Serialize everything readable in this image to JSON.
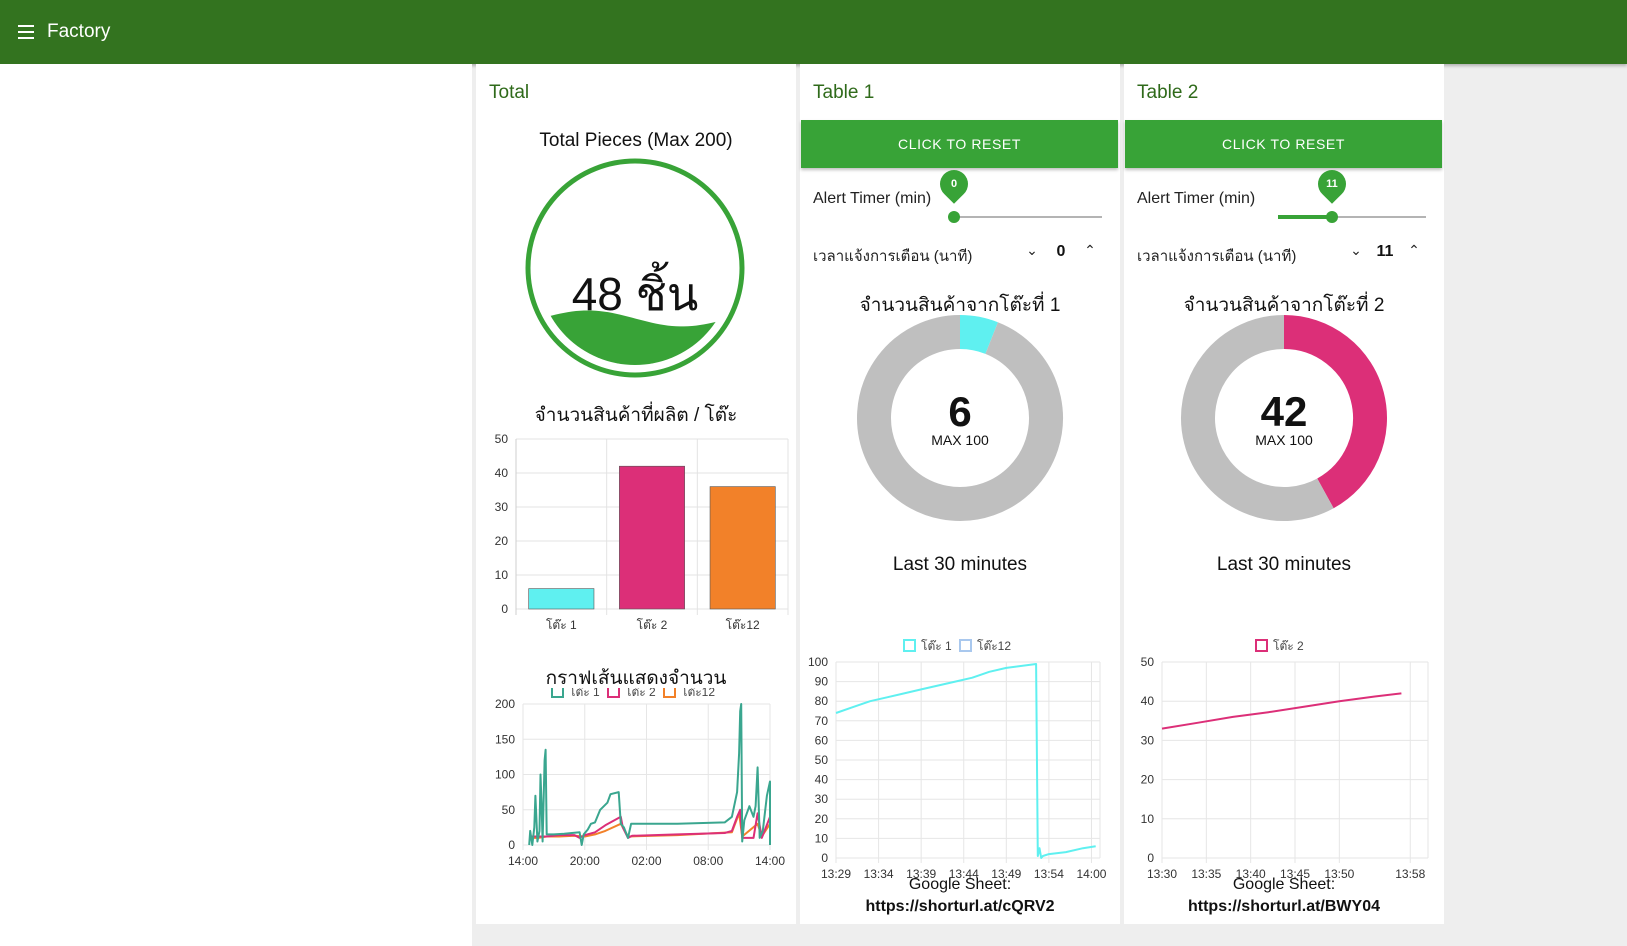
{
  "topbar": {
    "title": "Factory",
    "menu_icon": "hamburger-menu-icon"
  },
  "total": {
    "group_title": "Total",
    "gauge": {
      "title": "Total Pieces (Max 200)",
      "value": 48,
      "max": 200,
      "text": "48 ชิ้น",
      "color": "#38a337"
    },
    "bar_title": "จำนวนสินค้าที่ผลิต / โต๊ะ",
    "line_title": "กราฟเส้นแสดงจำนวน"
  },
  "table1": {
    "group_title": "Table 1",
    "reset_label": "CLICK TO RESET",
    "slider_label": "Alert Timer (min)",
    "slider_value": 0,
    "slider_max": 60,
    "numeric_label": "เวลาแจ้งการเตือน (นาที)",
    "numeric_value": "0",
    "donut_title": "จำนวนสินค้าจากโต๊ะที่ 1",
    "donut_value": "6",
    "donut_max_label": "MAX 100",
    "line_title": "Last 30 minutes",
    "sheet_label": "Google Sheet:",
    "sheet_link": "https://shorturl.at/cQRV2"
  },
  "table2": {
    "group_title": "Table 2",
    "reset_label": "CLICK TO RESET",
    "slider_label": "Alert Timer (min)",
    "slider_value": 11,
    "slider_max": 30,
    "numeric_label": "เวลาแจ้งการเตือน (นาที)",
    "numeric_value": "11",
    "donut_title": "จำนวนสินค้าจากโต๊ะที่ 2",
    "donut_value": "42",
    "donut_max_label": "MAX 100",
    "line_title": "Last 30 minutes",
    "sheet_label": "Google Sheet:",
    "sheet_link": "https://shorturl.at/BWY04"
  },
  "chart_data": [
    {
      "id": "totalGauge",
      "type": "gauge",
      "title": "Total Pieces (Max 200)",
      "value": 48,
      "max": 200,
      "label": "48 ชิ้น",
      "color": "#38a337"
    },
    {
      "id": "totalBar",
      "type": "bar",
      "title": "จำนวนสินค้าที่ผลิต / โต๊ะ",
      "categories": [
        "โต๊ะ 1",
        "โต๊ะ 2",
        "โต๊ะ12"
      ],
      "values": [
        6,
        42,
        36
      ],
      "colors": [
        "#5ff0f0",
        "#dc2f78",
        "#f28129"
      ],
      "ylim": [
        0,
        50
      ],
      "yticks": [
        0,
        10,
        20,
        30,
        40,
        50
      ],
      "grid": true
    },
    {
      "id": "totalLine",
      "type": "line",
      "title": "กราฟเส้นแสดงจำนวน",
      "ylim": [
        0,
        200
      ],
      "yticks": [
        0,
        50,
        100,
        150,
        200
      ],
      "xlim": [
        0,
        24
      ],
      "xticks": [
        0,
        6,
        12,
        18,
        24
      ],
      "xtick_labels": [
        "14:00",
        "20:00",
        "02:00",
        "08:00",
        "14:00"
      ],
      "legend": "top",
      "series": [
        {
          "name": "โต๊ะ 1",
          "color": "#3aa68f",
          "points": [
            [
              0.6,
              0
            ],
            [
              0.7,
              20
            ],
            [
              0.9,
              0
            ],
            [
              1.1,
              25
            ],
            [
              1.2,
              70
            ],
            [
              1.4,
              5
            ],
            [
              1.6,
              20
            ],
            [
              1.7,
              100
            ],
            [
              1.8,
              60
            ],
            [
              1.9,
              5
            ],
            [
              2.1,
              120
            ],
            [
              2.2,
              135
            ],
            [
              2.3,
              15
            ],
            [
              3.0,
              15
            ],
            [
              4.0,
              16
            ],
            [
              5.5,
              18
            ],
            [
              5.7,
              0
            ],
            [
              5.9,
              15
            ],
            [
              6.3,
              22
            ],
            [
              6.6,
              30
            ],
            [
              7.0,
              32
            ],
            [
              7.5,
              50
            ],
            [
              8.2,
              60
            ],
            [
              8.5,
              72
            ],
            [
              9.3,
              75
            ],
            [
              9.5,
              30
            ],
            [
              9.8,
              25
            ],
            [
              10.2,
              10
            ],
            [
              10.5,
              30
            ],
            [
              11.5,
              30
            ],
            [
              15.0,
              30
            ],
            [
              19.6,
              32
            ],
            [
              20.3,
              40
            ],
            [
              20.8,
              75
            ],
            [
              21.0,
              130
            ],
            [
              21.1,
              190
            ],
            [
              21.2,
              200
            ],
            [
              21.3,
              5
            ],
            [
              21.5,
              35
            ],
            [
              22.0,
              55
            ],
            [
              22.4,
              40
            ],
            [
              22.6,
              55
            ],
            [
              22.8,
              110
            ],
            [
              23.0,
              10
            ],
            [
              23.3,
              20
            ],
            [
              23.7,
              70
            ],
            [
              24.0,
              90
            ],
            [
              24.0,
              0
            ]
          ]
        },
        {
          "name": "โต๊ะ 2",
          "color": "#dc2f78",
          "points": [
            [
              0.7,
              12
            ],
            [
              1.5,
              12
            ],
            [
              2.3,
              12
            ],
            [
              3.5,
              14
            ],
            [
              5.0,
              14
            ],
            [
              5.5,
              10
            ],
            [
              6.0,
              14
            ],
            [
              7.0,
              18
            ],
            [
              8.0,
              28
            ],
            [
              9.5,
              40
            ],
            [
              9.7,
              25
            ],
            [
              10.2,
              10
            ],
            [
              10.6,
              13
            ],
            [
              15.0,
              15
            ],
            [
              19.6,
              17
            ],
            [
              20.3,
              20
            ],
            [
              20.8,
              40
            ],
            [
              21.1,
              50
            ],
            [
              21.3,
              10
            ],
            [
              22.4,
              10
            ],
            [
              22.8,
              45
            ],
            [
              23.2,
              10
            ],
            [
              24.0,
              40
            ],
            [
              24.0,
              5
            ]
          ]
        },
        {
          "name": "โต๊ะ12",
          "color": "#f28129",
          "points": [
            [
              0.7,
              10
            ],
            [
              1.5,
              10
            ],
            [
              2.3,
              12
            ],
            [
              3.5,
              12
            ],
            [
              5.0,
              13
            ],
            [
              6.0,
              12
            ],
            [
              7.0,
              15
            ],
            [
              8.0,
              20
            ],
            [
              9.5,
              30
            ],
            [
              10.2,
              12
            ],
            [
              15.0,
              14
            ],
            [
              20.3,
              18
            ],
            [
              21.0,
              45
            ],
            [
              21.3,
              12
            ],
            [
              22.8,
              30
            ],
            [
              23.2,
              12
            ],
            [
              24.0,
              30
            ]
          ]
        }
      ]
    },
    {
      "id": "t1Donut",
      "type": "pie",
      "title": "จำนวนสินค้าจากโต๊ะที่ 1",
      "values": [
        6,
        94
      ],
      "center_label": "6",
      "sub_label": "MAX 100",
      "colors": [
        "#5ff0f0",
        "#bfbfbf"
      ]
    },
    {
      "id": "t1Line",
      "type": "line",
      "title": "Last 30 minutes",
      "ylim": [
        0,
        100
      ],
      "yticks": [
        0,
        10,
        20,
        30,
        40,
        50,
        60,
        70,
        80,
        90,
        100
      ],
      "xlim": [
        0,
        31
      ],
      "xticks": [
        0,
        5,
        10,
        15,
        20,
        25,
        30
      ],
      "xtick_labels": [
        "13:29",
        "13:34",
        "13:39",
        "13:44",
        "13:49",
        "13:54",
        "14:00"
      ],
      "legend": "top",
      "series": [
        {
          "name": "โต๊ะ 1",
          "color": "#5ff0f0",
          "points": [
            [
              0,
              74
            ],
            [
              2,
              77
            ],
            [
              4,
              80
            ],
            [
              6,
              82
            ],
            [
              8,
              84
            ],
            [
              10,
              86
            ],
            [
              12,
              88
            ],
            [
              14,
              90
            ],
            [
              16,
              92
            ],
            [
              18,
              95
            ],
            [
              20,
              97
            ],
            [
              23.5,
              99
            ],
            [
              23.7,
              1
            ],
            [
              23.9,
              5
            ],
            [
              24.1,
              0
            ],
            [
              24.3,
              1
            ],
            [
              25,
              2
            ],
            [
              27,
              3
            ],
            [
              29,
              5
            ],
            [
              30.5,
              6
            ]
          ]
        },
        {
          "name": "โต๊ะ12",
          "color": "#a9c8ee",
          "points": []
        }
      ]
    },
    {
      "id": "t2Donut",
      "type": "pie",
      "title": "จำนวนสินค้าจากโต๊ะที่ 2",
      "values": [
        42,
        58
      ],
      "center_label": "42",
      "sub_label": "MAX 100",
      "colors": [
        "#dc2f78",
        "#bfbfbf"
      ]
    },
    {
      "id": "t2Line",
      "type": "line",
      "title": "Last 30 minutes",
      "ylim": [
        0,
        50
      ],
      "yticks": [
        0,
        10,
        20,
        30,
        40,
        50
      ],
      "xlim": [
        0,
        30
      ],
      "xticks": [
        0,
        5,
        10,
        15,
        20,
        28
      ],
      "xtick_labels": [
        "13:30",
        "13:35",
        "13:40",
        "13:45",
        "13:50",
        "13:58"
      ],
      "legend": "top",
      "series": [
        {
          "name": "โต๊ะ 2",
          "color": "#dc2f78",
          "points": [
            [
              0,
              33
            ],
            [
              4,
              34.5
            ],
            [
              8,
              36
            ],
            [
              12,
              37.2
            ],
            [
              16,
              38.6
            ],
            [
              20,
              40
            ],
            [
              24,
              41.2
            ],
            [
              27,
              42
            ]
          ]
        }
      ]
    }
  ]
}
